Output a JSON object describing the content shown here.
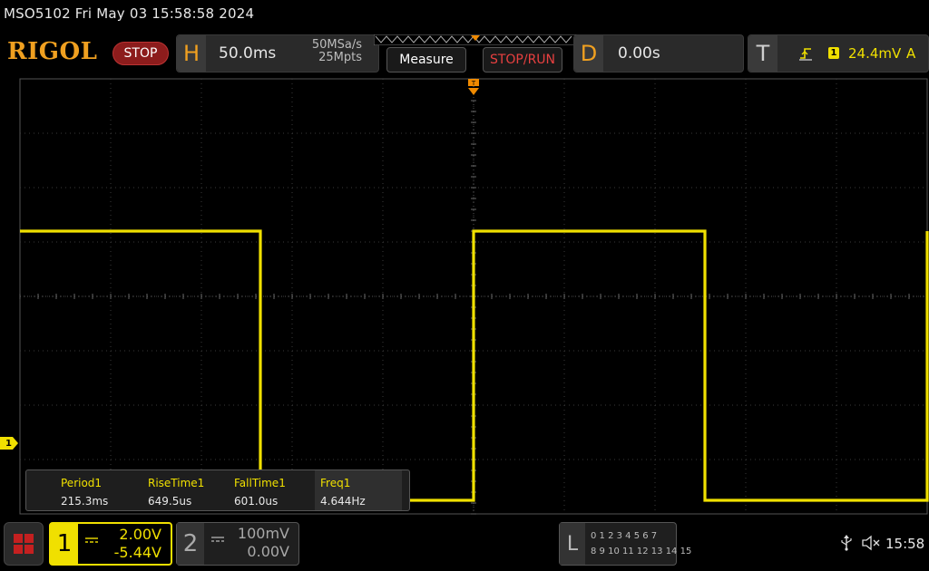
{
  "header": {
    "title_line": "MSO5102  Fri May 03 15:58:58 2024"
  },
  "logo": "RIGOL",
  "run_state": "STOP",
  "horizontal": {
    "letter": "H",
    "timebase": "50.0ms",
    "sample_rate": "50MSa/s",
    "memory_depth": "25Mpts"
  },
  "buttons": {
    "measure": "Measure",
    "stop_run": "STOP/RUN"
  },
  "delay": {
    "letter": "D",
    "value": "0.00s"
  },
  "trigger": {
    "letter": "T",
    "source": "1",
    "level": "24.4mV",
    "mode": "A",
    "edge_icon": "rising-edge-icon"
  },
  "channel1": {
    "number": "1",
    "scale": "2.00V",
    "offset": "-5.44V",
    "color": "#f0e000",
    "ground_marker": "1"
  },
  "channel2": {
    "number": "2",
    "scale": "100mV",
    "offset": "0.00V"
  },
  "measurements": [
    {
      "name": "Period1",
      "value": "215.3ms"
    },
    {
      "name": "RiseTime1",
      "value": "649.5us"
    },
    {
      "name": "FallTime1",
      "value": "601.0us"
    },
    {
      "name": "Freq1",
      "value": "4.644Hz"
    }
  ],
  "logic": {
    "letter": "L",
    "row1": "0 1 2 3   4 5 6 7",
    "row2": "8 9 10 11 12 13 14 15"
  },
  "status": {
    "time": "15:58"
  },
  "waveform": {
    "grid_divisions": {
      "horizontal": 10,
      "vertical": 8
    },
    "transitions_div": [
      2.65,
      5.0,
      7.55,
      10.0
    ],
    "high_level_div": 5.2,
    "low_level_div": 0.25
  }
}
